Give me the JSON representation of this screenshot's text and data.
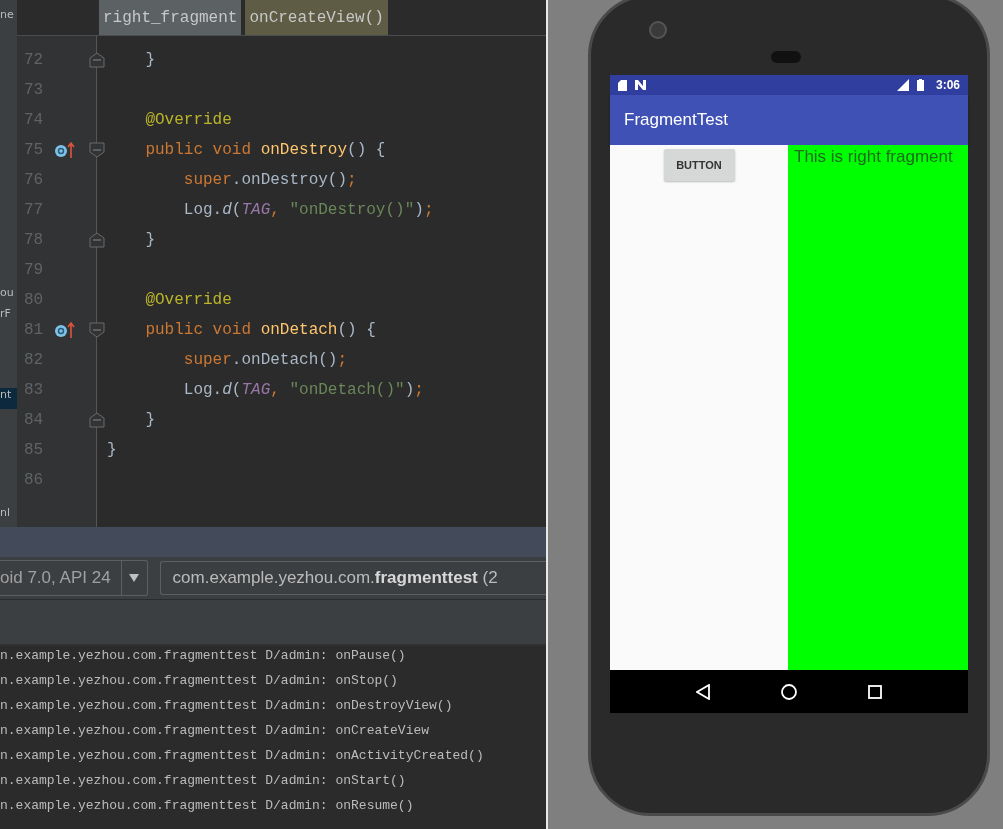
{
  "project_panel": [
    {
      "text": "ne",
      "selected": false
    },
    {
      "text": "ou",
      "selected": false
    },
    {
      "text": "rF",
      "selected": false
    },
    {
      "text": "nt",
      "selected": true
    },
    {
      "text": "nl",
      "selected": false
    }
  ],
  "editor": {
    "breadcrumbs": [
      {
        "kind": "class",
        "text": "right_fragment"
      },
      {
        "kind": "method",
        "text": "onCreateView()"
      }
    ],
    "lines": [
      {
        "number": "72",
        "fold_end": true,
        "tokens": [
          {
            "kind": "plain",
            "text": "    }"
          }
        ]
      },
      {
        "number": "73"
      },
      {
        "number": "74",
        "tokens": [
          {
            "kind": "annotation",
            "text": "    @Override"
          }
        ]
      },
      {
        "number": "75",
        "override": true,
        "fold_start": true,
        "tokens": [
          {
            "kind": "keyword",
            "text": "    public void "
          },
          {
            "kind": "method",
            "text": "onDestroy"
          },
          {
            "kind": "plain",
            "text": "() {"
          }
        ]
      },
      {
        "number": "76",
        "tokens": [
          {
            "kind": "keyword",
            "text": "        super"
          },
          {
            "kind": "plain",
            "text": ".onDestroy()"
          },
          {
            "kind": "keyword",
            "text": ";"
          }
        ]
      },
      {
        "number": "77",
        "tokens": [
          {
            "kind": "plain",
            "text": "        Log."
          },
          {
            "kind": "call",
            "text": "d"
          },
          {
            "kind": "plain",
            "text": "("
          },
          {
            "kind": "constant",
            "text": "TAG"
          },
          {
            "kind": "keyword",
            "text": ", "
          },
          {
            "kind": "string",
            "text": "\"onDestroy()\""
          },
          {
            "kind": "plain",
            "text": ")"
          },
          {
            "kind": "keyword",
            "text": ";"
          }
        ]
      },
      {
        "number": "78",
        "fold_end": true,
        "tokens": [
          {
            "kind": "plain",
            "text": "    }"
          }
        ]
      },
      {
        "number": "79"
      },
      {
        "number": "80",
        "tokens": [
          {
            "kind": "annotation",
            "text": "    @Override"
          }
        ]
      },
      {
        "number": "81",
        "override": true,
        "fold_start": true,
        "tokens": [
          {
            "kind": "keyword",
            "text": "    public void "
          },
          {
            "kind": "method",
            "text": "onDetach"
          },
          {
            "kind": "plain",
            "text": "() {"
          }
        ]
      },
      {
        "number": "82",
        "tokens": [
          {
            "kind": "keyword",
            "text": "        super"
          },
          {
            "kind": "plain",
            "text": ".onDetach()"
          },
          {
            "kind": "keyword",
            "text": ";"
          }
        ]
      },
      {
        "number": "83",
        "tokens": [
          {
            "kind": "plain",
            "text": "        Log."
          },
          {
            "kind": "call",
            "text": "d"
          },
          {
            "kind": "plain",
            "text": "("
          },
          {
            "kind": "constant",
            "text": "TAG"
          },
          {
            "kind": "keyword",
            "text": ", "
          },
          {
            "kind": "string",
            "text": "\"onDetach()\""
          },
          {
            "kind": "plain",
            "text": ")"
          },
          {
            "kind": "keyword",
            "text": ";"
          }
        ]
      },
      {
        "number": "84",
        "fold_end": true,
        "tokens": [
          {
            "kind": "plain",
            "text": "    }"
          }
        ]
      },
      {
        "number": "85",
        "tokens": [
          {
            "kind": "plain",
            "text": "}"
          }
        ]
      },
      {
        "number": "86"
      }
    ]
  },
  "logcat": {
    "device": "oid 7.0, API 24",
    "process": "com.example.yezhou.com.**fragmenttest** (2",
    "lines": [
      "n.example.yezhou.com.fragmenttest D/admin: onPause()",
      "n.example.yezhou.com.fragmenttest D/admin: onStop()",
      "n.example.yezhou.com.fragmenttest D/admin: onDestroyView()",
      "n.example.yezhou.com.fragmenttest D/admin: onCreateView",
      "n.example.yezhou.com.fragmenttest D/admin: onActivityCreated()",
      "n.example.yezhou.com.fragmenttest D/admin: onStart()",
      "n.example.yezhou.com.fragmenttest D/admin: onResume()"
    ]
  },
  "phone": {
    "time": "3:06",
    "app_title": "FragmentTest",
    "button": "BUTTON",
    "right_fragment_text": "This is right fragment"
  }
}
